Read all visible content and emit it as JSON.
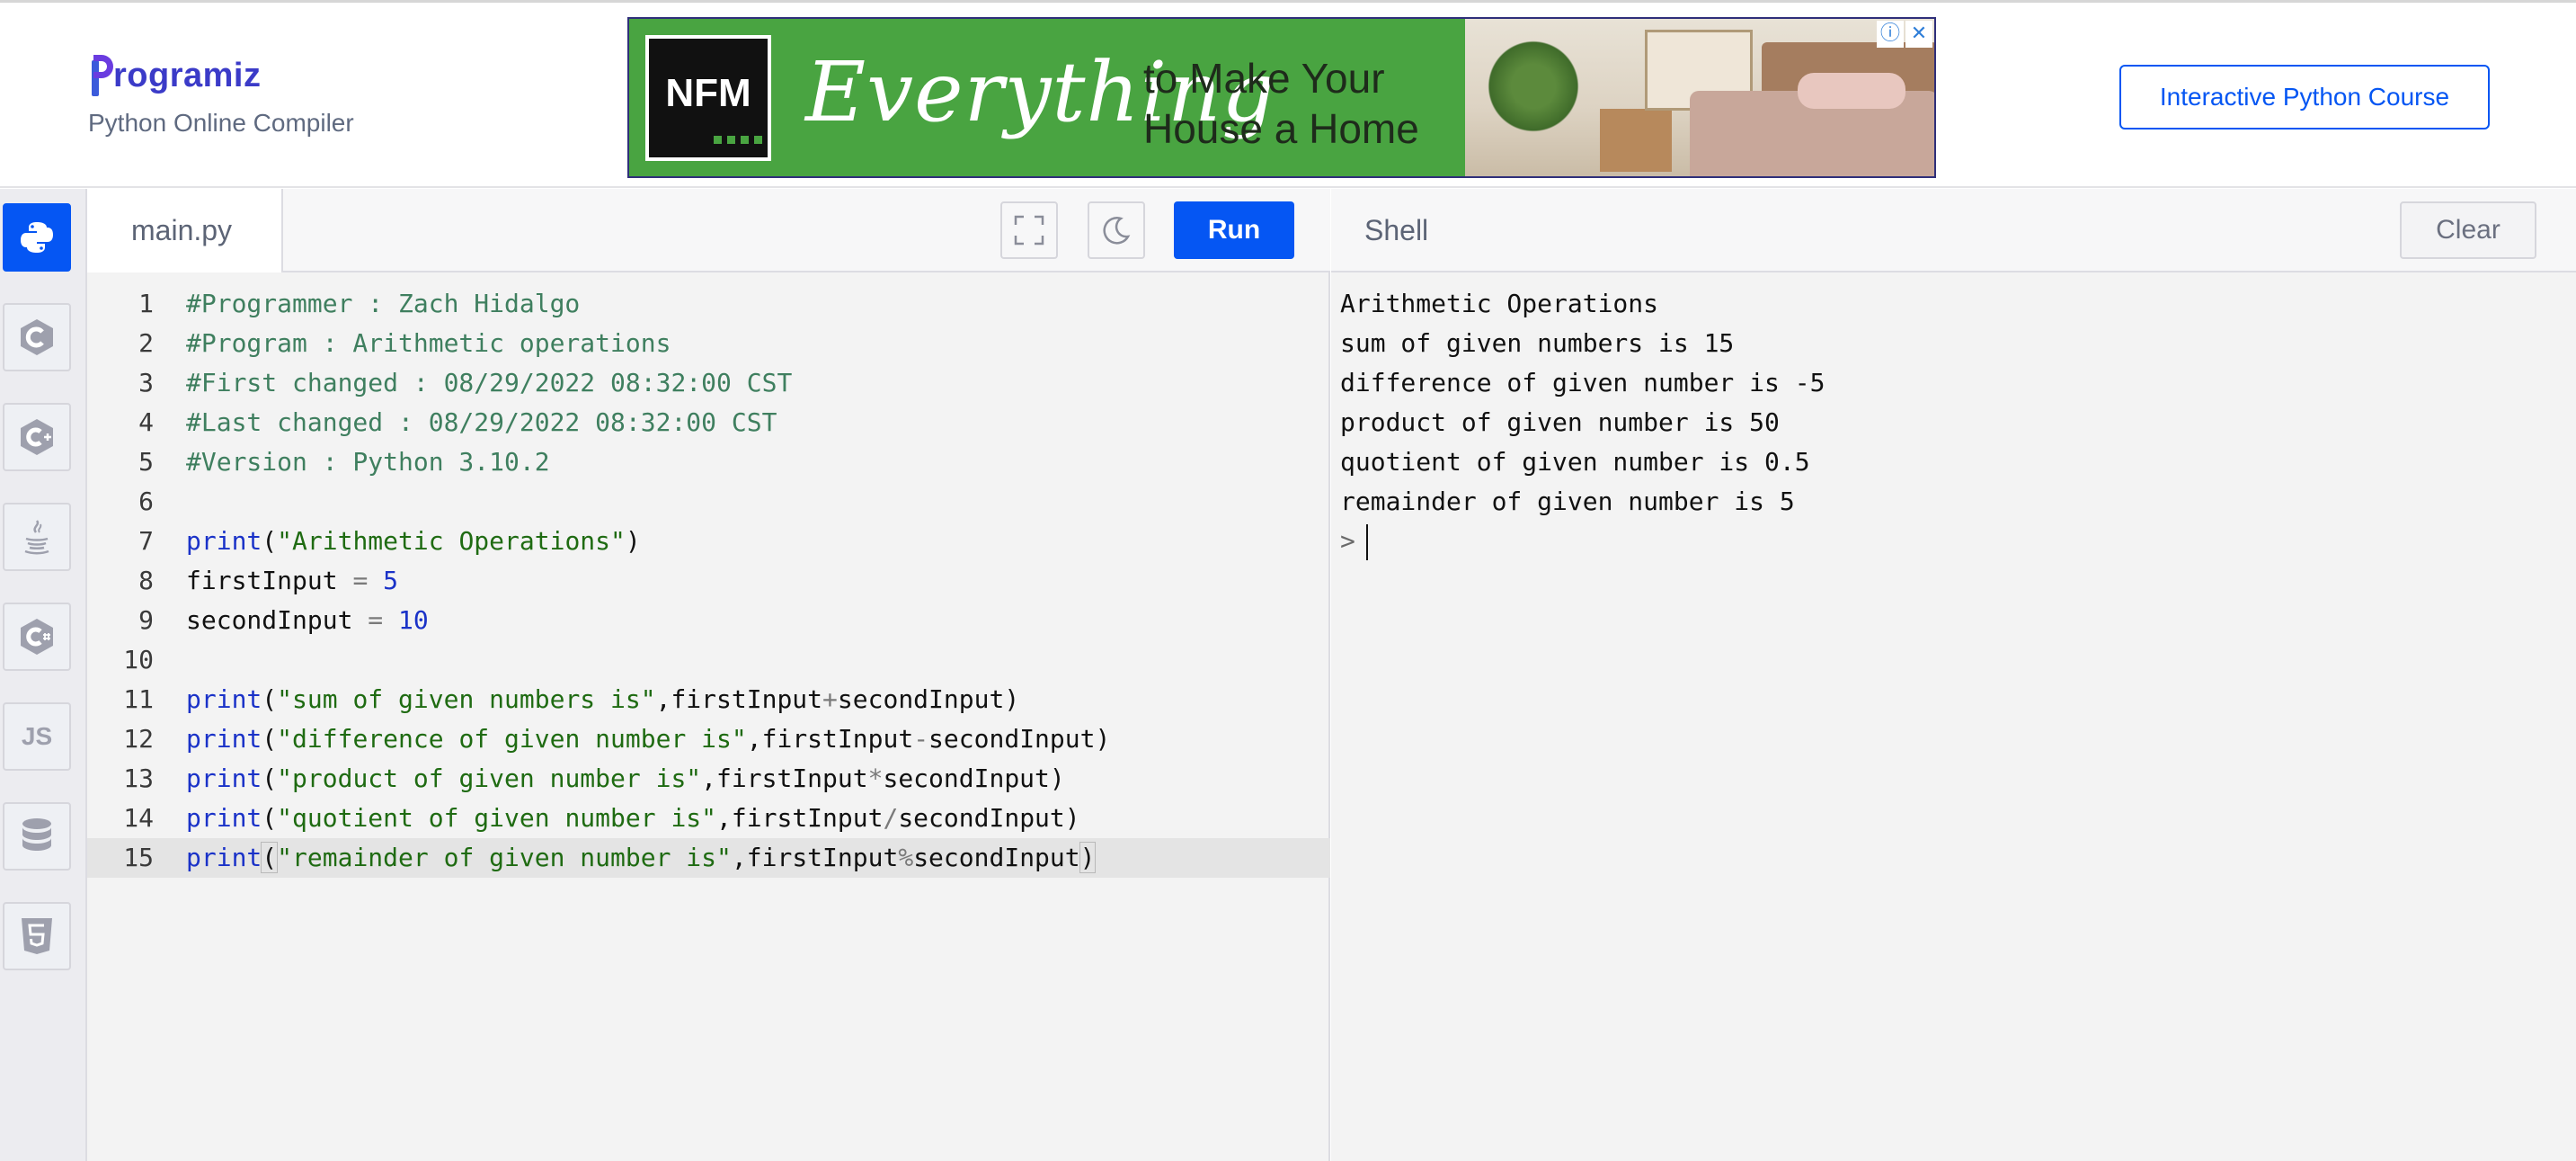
{
  "brand": {
    "logo_text": "rogramiz",
    "subtitle": "Python Online Compiler"
  },
  "ad": {
    "logo": "NFM",
    "headline": "Everything",
    "tagline_1": "to Make Your",
    "tagline_2": "House a Home",
    "info_glyph": "ⓘ",
    "close_glyph": "✕"
  },
  "header": {
    "course_button": "Interactive Python Course"
  },
  "sidebar": {
    "items": [
      {
        "icon": "python-icon",
        "active": true
      },
      {
        "icon": "c-icon",
        "active": false
      },
      {
        "icon": "cpp-icon",
        "active": false
      },
      {
        "icon": "java-icon",
        "active": false
      },
      {
        "icon": "csharp-icon",
        "active": false
      },
      {
        "icon": "javascript-icon",
        "label": "JS",
        "active": false
      },
      {
        "icon": "database-icon",
        "active": false
      },
      {
        "icon": "html5-icon",
        "active": false
      }
    ]
  },
  "editor": {
    "filename": "main.py",
    "run_label": "Run",
    "current_line": 15,
    "lines": [
      {
        "n": "1",
        "tokens": [
          {
            "t": "#Programmer : Zach Hidalgo",
            "k": "com"
          }
        ]
      },
      {
        "n": "2",
        "tokens": [
          {
            "t": "#Program : Arithmetic operations",
            "k": "com"
          }
        ]
      },
      {
        "n": "3",
        "tokens": [
          {
            "t": "#First changed : 08/29/2022 08:32:00 CST",
            "k": "com"
          }
        ]
      },
      {
        "n": "4",
        "tokens": [
          {
            "t": "#Last changed : 08/29/2022 08:32:00 CST",
            "k": "com"
          }
        ]
      },
      {
        "n": "5",
        "tokens": [
          {
            "t": "#Version : Python 3.10.2",
            "k": "com"
          }
        ]
      },
      {
        "n": "6",
        "tokens": []
      },
      {
        "n": "7",
        "tokens": [
          {
            "t": "print",
            "k": "fn"
          },
          {
            "t": "(",
            "k": ""
          },
          {
            "t": "\"Arithmetic Operations\"",
            "k": "str"
          },
          {
            "t": ")",
            "k": ""
          }
        ]
      },
      {
        "n": "8",
        "tokens": [
          {
            "t": "firstInput ",
            "k": ""
          },
          {
            "t": "=",
            "k": "op"
          },
          {
            "t": " ",
            "k": ""
          },
          {
            "t": "5",
            "k": "num"
          }
        ]
      },
      {
        "n": "9",
        "tokens": [
          {
            "t": "secondInput ",
            "k": ""
          },
          {
            "t": "=",
            "k": "op"
          },
          {
            "t": " ",
            "k": ""
          },
          {
            "t": "10",
            "k": "num"
          }
        ]
      },
      {
        "n": "10",
        "tokens": []
      },
      {
        "n": "11",
        "tokens": [
          {
            "t": "print",
            "k": "fn"
          },
          {
            "t": "(",
            "k": ""
          },
          {
            "t": "\"sum of given numbers is\"",
            "k": "str"
          },
          {
            "t": ",firstInput",
            "k": ""
          },
          {
            "t": "+",
            "k": "op"
          },
          {
            "t": "secondInput)",
            "k": ""
          }
        ]
      },
      {
        "n": "12",
        "tokens": [
          {
            "t": "print",
            "k": "fn"
          },
          {
            "t": "(",
            "k": ""
          },
          {
            "t": "\"difference of given number is\"",
            "k": "str"
          },
          {
            "t": ",firstInput",
            "k": ""
          },
          {
            "t": "-",
            "k": "op"
          },
          {
            "t": "secondInput)",
            "k": ""
          }
        ]
      },
      {
        "n": "13",
        "tokens": [
          {
            "t": "print",
            "k": "fn"
          },
          {
            "t": "(",
            "k": ""
          },
          {
            "t": "\"product of given number is\"",
            "k": "str"
          },
          {
            "t": ",firstInput",
            "k": ""
          },
          {
            "t": "*",
            "k": "op"
          },
          {
            "t": "secondInput)",
            "k": ""
          }
        ]
      },
      {
        "n": "14",
        "tokens": [
          {
            "t": "print",
            "k": "fn"
          },
          {
            "t": "(",
            "k": ""
          },
          {
            "t": "\"quotient of given number is\"",
            "k": "str"
          },
          {
            "t": ",firstInput",
            "k": ""
          },
          {
            "t": "/",
            "k": "op"
          },
          {
            "t": "secondInput)",
            "k": ""
          }
        ]
      },
      {
        "n": "15",
        "tokens": [
          {
            "t": "print",
            "k": "fn"
          },
          {
            "t": "(",
            "k": "brk"
          },
          {
            "t": "\"remainder of given number is\"",
            "k": "str"
          },
          {
            "t": ",firstInput",
            "k": ""
          },
          {
            "t": "%",
            "k": "op"
          },
          {
            "t": "secondInput",
            "k": ""
          },
          {
            "t": ")",
            "k": "brk"
          }
        ]
      }
    ]
  },
  "shell": {
    "title": "Shell",
    "clear_label": "Clear",
    "prompt": ">",
    "output": [
      "Arithmetic Operations",
      "sum of given numbers is 15",
      "difference of given number is -5",
      "product of given number is 50",
      "quotient of given number is 0.5",
      "remainder of given number is 5"
    ]
  },
  "colors": {
    "accent": "#0556f3",
    "comment": "#3f7f5f",
    "keyword": "#1a32c8",
    "string": "#1f6b12"
  }
}
